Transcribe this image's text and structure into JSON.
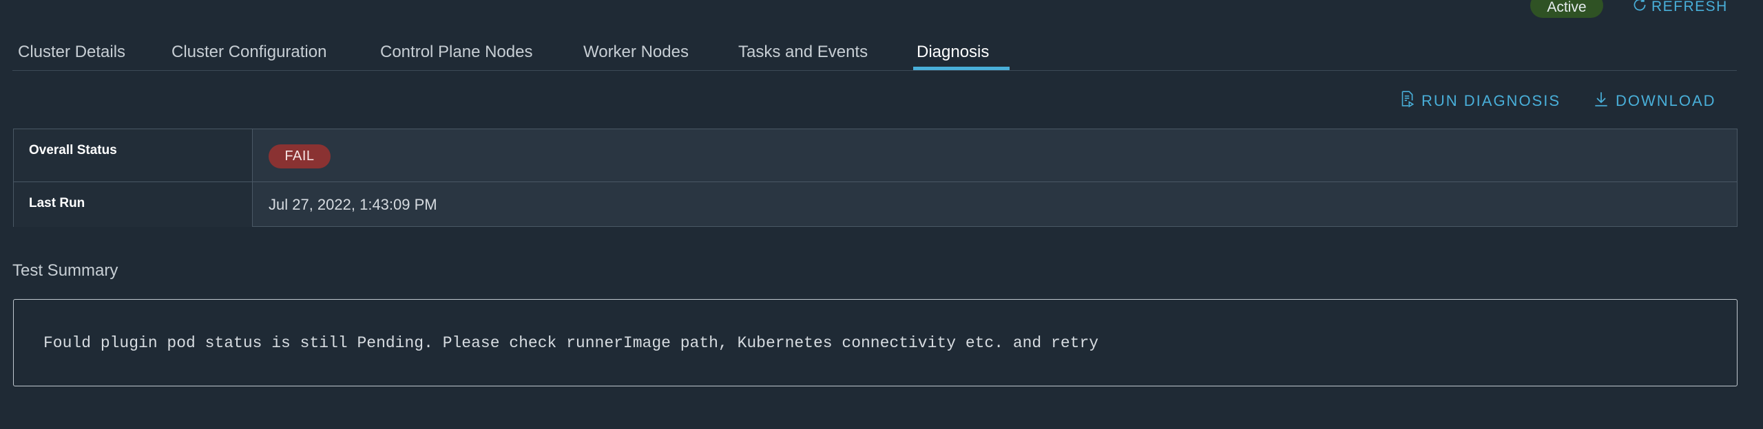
{
  "header": {
    "status": "Active",
    "refresh_label": "REFRESH"
  },
  "tabs": [
    {
      "label": "Cluster Details"
    },
    {
      "label": "Cluster Configuration"
    },
    {
      "label": "Control Plane Nodes"
    },
    {
      "label": "Worker Nodes"
    },
    {
      "label": "Tasks and Events"
    },
    {
      "label": "Diagnosis",
      "active": true
    }
  ],
  "toolbar": {
    "run_diagnosis_label": "RUN DIAGNOSIS",
    "download_label": "DOWNLOAD"
  },
  "details": {
    "overall_status_label": "Overall Status",
    "overall_status_value": "FAIL",
    "last_run_label": "Last Run",
    "last_run_value": "Jul 27, 2022, 1:43:09 PM"
  },
  "summary": {
    "title": "Test Summary",
    "message": "Fould plugin pod status is still Pending. Please check runnerImage path, Kubernetes connectivity etc. and retry"
  },
  "colors": {
    "accent": "#49afd9",
    "active_badge": "#2f5224",
    "fail_badge": "#8a3232",
    "background": "#1f2a35"
  }
}
